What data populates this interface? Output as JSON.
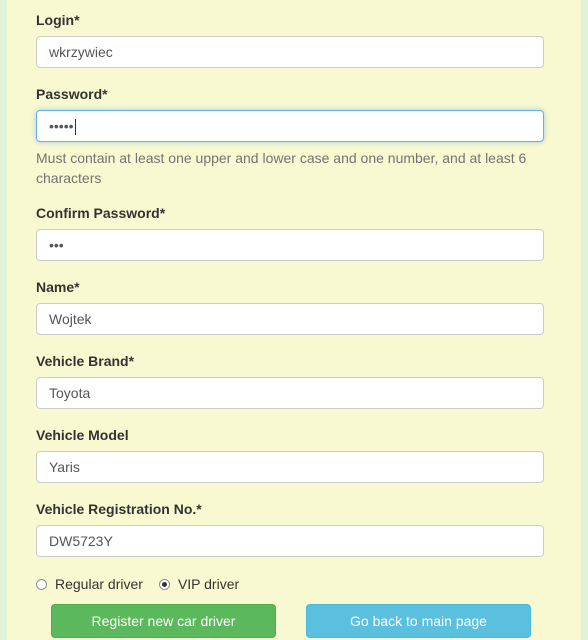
{
  "form": {
    "login": {
      "label": "Login*",
      "value": "wkrzywiec"
    },
    "password": {
      "label": "Password*",
      "value": "•••••",
      "help": "Must contain at least one upper and lower case and one number, and at least 6 characters"
    },
    "confirm_password": {
      "label": "Confirm Password*",
      "value": "•••"
    },
    "name": {
      "label": "Name*",
      "value": "Wojtek"
    },
    "vehicle_brand": {
      "label": "Vehicle Brand*",
      "value": "Toyota"
    },
    "vehicle_model": {
      "label": "Vehicle Model",
      "value": "Yaris"
    },
    "registration": {
      "label": "Vehicle Registration No.*",
      "value": "DW5723Y"
    },
    "driver_type": {
      "options": [
        {
          "label": "Regular driver",
          "selected": false
        },
        {
          "label": "VIP driver",
          "selected": true
        }
      ]
    }
  },
  "buttons": {
    "register": "Register new car driver",
    "back": "Go back to main page"
  },
  "colors": {
    "panel": "#f9f9d1",
    "side": "#dff3d6",
    "success": "#5cb85c",
    "info": "#5bc0de",
    "focus": "#66afe9"
  }
}
